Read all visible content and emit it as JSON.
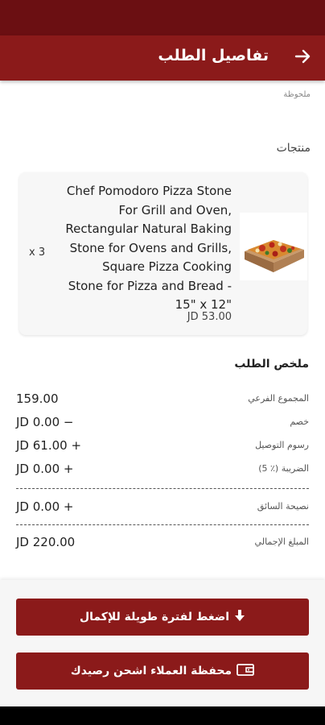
{
  "header": {
    "title": "تفاصيل الطلب",
    "back_icon": "arrow-right-icon"
  },
  "note": {
    "label": "ملحوظة"
  },
  "products": {
    "heading": "منتجات",
    "items": [
      {
        "name": "Chef Pomodoro Pizza Stone For Grill and Oven, Rectangular Natural Baking Stone for Ovens and Grills, Square Pizza Cooking Stone for Pizza and Bread - 15\" x 12\"",
        "price": "JD 53.00",
        "quantity": "x 3",
        "image_icon": "pizza-image"
      }
    ]
  },
  "summary": {
    "heading": "ملخص الطلب",
    "rows": [
      {
        "label": "المجموع الفرعي",
        "value": "159.00"
      },
      {
        "label": "خصم",
        "value": "JD 0.00 −"
      },
      {
        "label": "رسوم التوصيل",
        "value": "JD 61.00 +"
      },
      {
        "label": "الضريبة (٪ 5)",
        "value": "JD 0.00 +"
      }
    ],
    "tip": {
      "label": "نصيحة السائق",
      "value": "JD 0.00 +"
    },
    "total": {
      "label": "المبلغ الإجمالي",
      "value": "JD 220.00"
    }
  },
  "actions": {
    "hold_button": {
      "label": "اضغط لفترة طويلة للإكمال",
      "icon": "arrow-down-icon"
    },
    "wallet_button": {
      "label": "محفظة العملاء اشحن رصيدك",
      "icon": "wallet-icon"
    }
  },
  "colors": {
    "primary": "#8b1a1a",
    "status_bar": "#6b0f12"
  }
}
